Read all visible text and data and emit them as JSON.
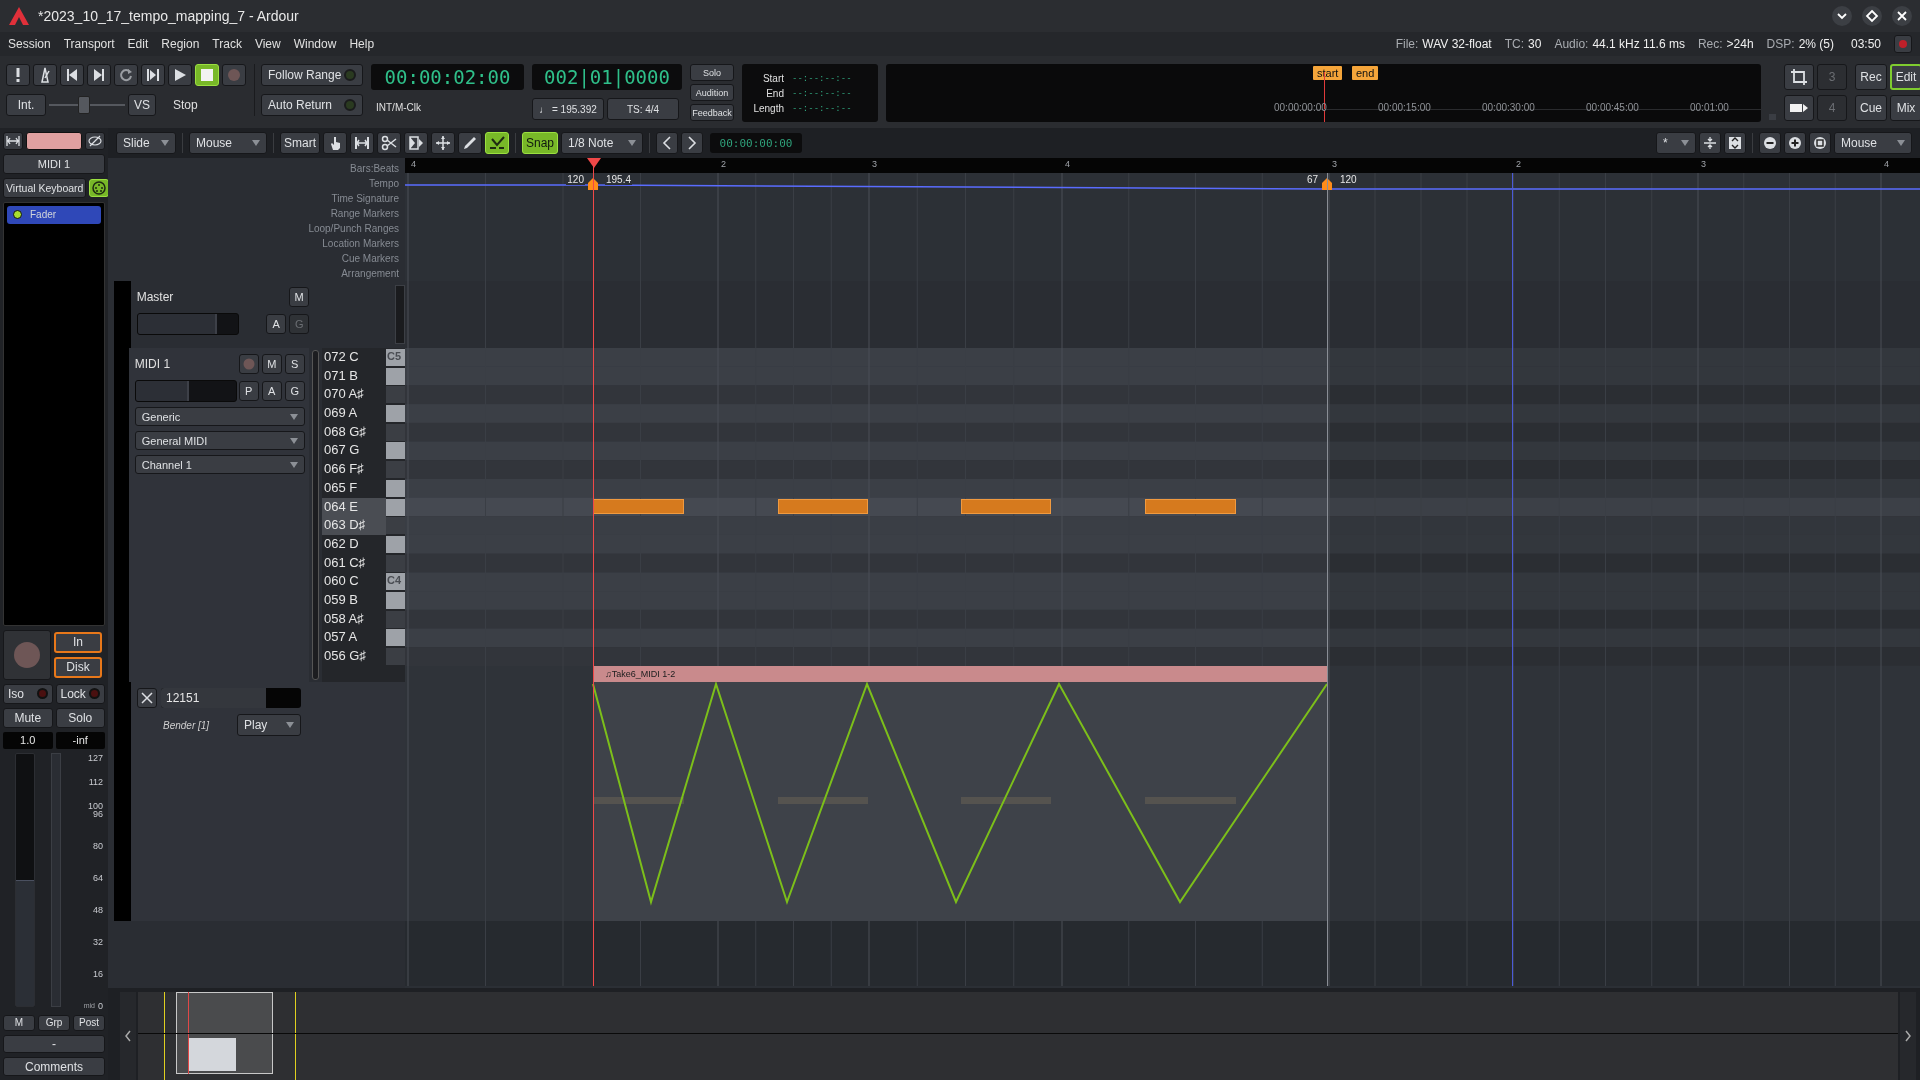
{
  "window": {
    "title": "*2023_10_17_tempo_mapping_7 - Ardour"
  },
  "menu": [
    "Session",
    "Transport",
    "Edit",
    "Region",
    "Track",
    "View",
    "Window",
    "Help"
  ],
  "status": [
    {
      "label": "File:",
      "value": "WAV 32-float"
    },
    {
      "label": "TC:",
      "value": "30"
    },
    {
      "label": "Audio:",
      "value": "44.1 kHz 11.6 ms"
    },
    {
      "label": "Rec:",
      "value": ">24h"
    },
    {
      "label": "DSP:",
      "value": "2% (5)"
    }
  ],
  "clock": "03:50",
  "transport": {
    "buttons": [
      {
        "kind": "panic",
        "on": false
      },
      {
        "kind": "metronome",
        "on": false
      },
      {
        "kind": "to_start",
        "on": false
      },
      {
        "kind": "to_end",
        "on": false
      },
      {
        "kind": "loop",
        "on": false
      },
      {
        "kind": "play_range",
        "on": false
      },
      {
        "kind": "play",
        "on": false
      },
      {
        "kind": "stop",
        "on": true
      },
      {
        "kind": "record",
        "on": false
      }
    ],
    "sync": "Int.",
    "shuttle": {
      "level": 0.46
    },
    "vari_speed": "VS",
    "state": "Stop",
    "follow_range": {
      "label": "Follow Range",
      "on": false
    },
    "auto_return": {
      "label": "Auto Return",
      "on": false
    },
    "primary_clock": "00:00:02:00",
    "clock_source": "INT/M-Clk",
    "secondary_clock": "002|01|0000",
    "tempo": "♩ = 195.392",
    "meter": "TS: 4/4",
    "monitor": [
      "Solo",
      "Audition",
      "Feedback"
    ],
    "selection": [
      {
        "label": "Start",
        "value": "--:--:--:--"
      },
      {
        "label": "End",
        "value": "--:--:--:--"
      },
      {
        "label": "Length",
        "value": "--:--:--:--"
      }
    ],
    "mini_timeline": {
      "markers": [
        "start",
        "end"
      ],
      "times": [
        "00:00:00:00",
        "00:00:15:00",
        "00:00:30:00",
        "00:00:45:00",
        "00:01:00"
      ]
    },
    "slots": [
      "3",
      "4"
    ],
    "pages": [
      {
        "label": "Rec",
        "selected": false
      },
      {
        "label": "Edit",
        "selected": true
      },
      {
        "label": "Cue",
        "selected": false
      },
      {
        "label": "Mix",
        "selected": false
      }
    ]
  },
  "editor_toolbar": {
    "edit_mode": "Slide",
    "edit_point": "Mouse",
    "smart": {
      "label": "Smart",
      "on": false
    },
    "tools": [
      {
        "kind": "grab",
        "selected": false
      },
      {
        "kind": "range",
        "selected": false
      },
      {
        "kind": "cut",
        "selected": false
      },
      {
        "kind": "stretch",
        "selected": false
      },
      {
        "kind": "audition",
        "selected": false
      },
      {
        "kind": "draw",
        "selected": false
      },
      {
        "kind": "internal_edit",
        "selected": true
      }
    ],
    "snap": {
      "label": "Snap",
      "on": true
    },
    "grid": "1/8 Note",
    "nudge_clock": "00:00:00:00",
    "visible_tracks": "*",
    "zoom_focus": "Mouse"
  },
  "strip": {
    "name": "MIDI 1",
    "virtual_keyboard": "Virtual Keyboard",
    "processors": [
      {
        "name": "Fader",
        "selected": true,
        "active": true
      }
    ],
    "monitoring": [
      {
        "label": "In",
        "highlighted": true
      },
      {
        "label": "Disk",
        "highlighted": true
      }
    ],
    "iso": {
      "label": "Iso",
      "on": false
    },
    "lock": {
      "label": "Lock",
      "on": false
    },
    "mute": "Mute",
    "solo": "Solo",
    "gain": "1.0",
    "peak": "-inf",
    "fader": {
      "level": 0.5
    },
    "scale": [
      "127",
      "112",
      "100",
      "96",
      "80",
      "64",
      "48",
      "32",
      "16",
      "0"
    ],
    "scale_mid": "mid",
    "bottom": [
      "M",
      "Grp",
      "Post"
    ],
    "dash": "-",
    "comments": "Comments"
  },
  "rulers": [
    "Bars:Beats",
    "Tempo",
    "Time Signature",
    "Range Markers",
    "Loop/Punch Ranges",
    "Location Markers",
    "Cue Markers",
    "Arrangement"
  ],
  "bars": [
    "4",
    "2",
    "3",
    "4",
    "3",
    "2",
    "3",
    "4"
  ],
  "tempo_markers": [
    {
      "before": "120",
      "after": "195.4"
    },
    {
      "before": "67",
      "after": "120"
    }
  ],
  "master": {
    "name": "Master",
    "buttons": [
      {
        "label": "M",
        "disabled": false
      },
      {
        "label": "A",
        "disabled": false
      },
      {
        "label": "G",
        "disabled": true
      }
    ],
    "gain": {
      "level": 0.79
    }
  },
  "midi_track": {
    "name": "MIDI 1",
    "rec_enabled": false,
    "buttons": [
      {
        "label": "M",
        "disabled": false
      },
      {
        "label": "S",
        "disabled": false
      },
      {
        "label": "P",
        "disabled": false
      },
      {
        "label": "A",
        "disabled": false
      },
      {
        "label": "G",
        "disabled": false
      }
    ],
    "gain": {
      "level": 0.53
    },
    "selectors": [
      "Generic",
      "General MIDI",
      "Channel  1"
    ],
    "keys": [
      {
        "label": "072 C",
        "black": false,
        "selected": false,
        "octave": "C5"
      },
      {
        "label": "071 B",
        "black": false,
        "selected": false
      },
      {
        "label": "070 A♯",
        "black": true,
        "selected": false
      },
      {
        "label": "069 A",
        "black": false,
        "selected": false
      },
      {
        "label": "068 G♯",
        "black": true,
        "selected": false
      },
      {
        "label": "067 G",
        "black": false,
        "selected": false
      },
      {
        "label": "066 F♯",
        "black": true,
        "selected": false
      },
      {
        "label": "065 F",
        "black": false,
        "selected": false
      },
      {
        "label": "064 E",
        "black": false,
        "selected": true
      },
      {
        "label": "063 D♯",
        "black": true,
        "selected": true
      },
      {
        "label": "062 D",
        "black": false,
        "selected": false
      },
      {
        "label": "061 C♯",
        "black": true,
        "selected": false
      },
      {
        "label": "060 C",
        "black": false,
        "selected": false,
        "octave": "C4"
      },
      {
        "label": "059 B",
        "black": false,
        "selected": false
      },
      {
        "label": "058 A♯",
        "black": true,
        "selected": false
      },
      {
        "label": "057 A",
        "black": false,
        "selected": false
      },
      {
        "label": "056 G♯",
        "black": true,
        "selected": false
      }
    ],
    "region": {
      "name": "♫Take6_MIDI 1-2"
    },
    "automation": {
      "value": "12151",
      "level": 0.75,
      "label": "Bender [1]",
      "mode": "Play"
    }
  }
}
